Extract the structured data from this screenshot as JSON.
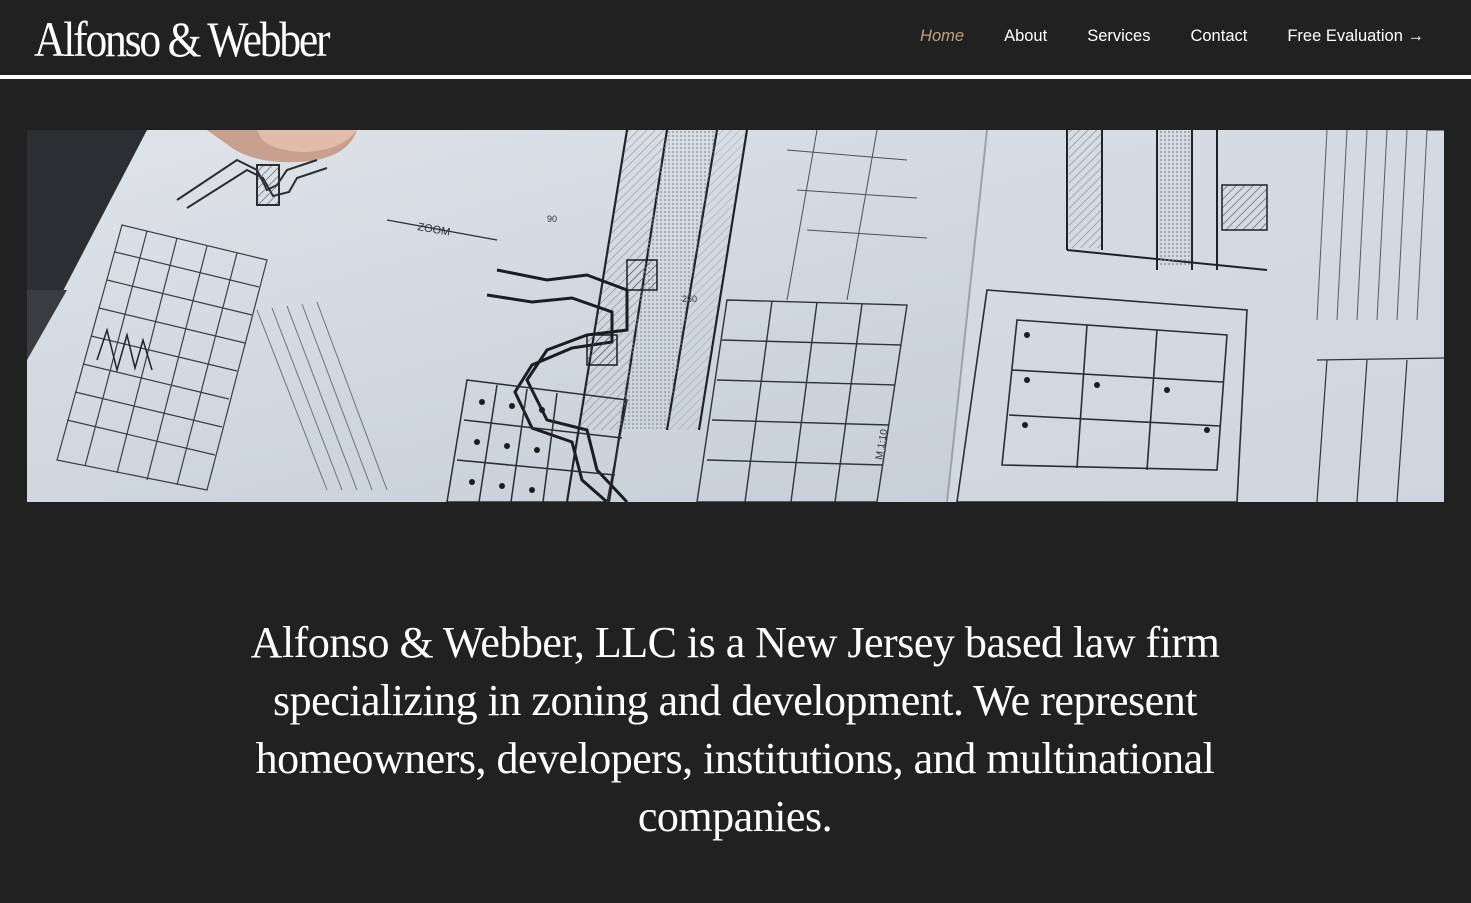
{
  "brand": {
    "logo_text": "Alfonso & Webber"
  },
  "nav": {
    "items": [
      {
        "label": "Home",
        "active": true
      },
      {
        "label": "About",
        "active": false
      },
      {
        "label": "Services",
        "active": false
      },
      {
        "label": "Contact",
        "active": false
      },
      {
        "label": "Free Evaluation →",
        "active": false
      }
    ]
  },
  "hero": {
    "image_subject": "architectural blueprint drawings on a table",
    "drawing_labels": {
      "zoom": "ZOOM",
      "dim_a": "250",
      "dim_b": "90",
      "dim_c": "M 1:10"
    }
  },
  "intro": {
    "text": "Alfonso & Webber, LLC is a New Jersey based law firm specializing in zoning and development. We represent homeowners, developers, institutions, and multinational companies."
  },
  "colors": {
    "background": "#212121",
    "text": "#ffffff",
    "nav_active": "#c2a27e",
    "divider": "#ffffff"
  }
}
